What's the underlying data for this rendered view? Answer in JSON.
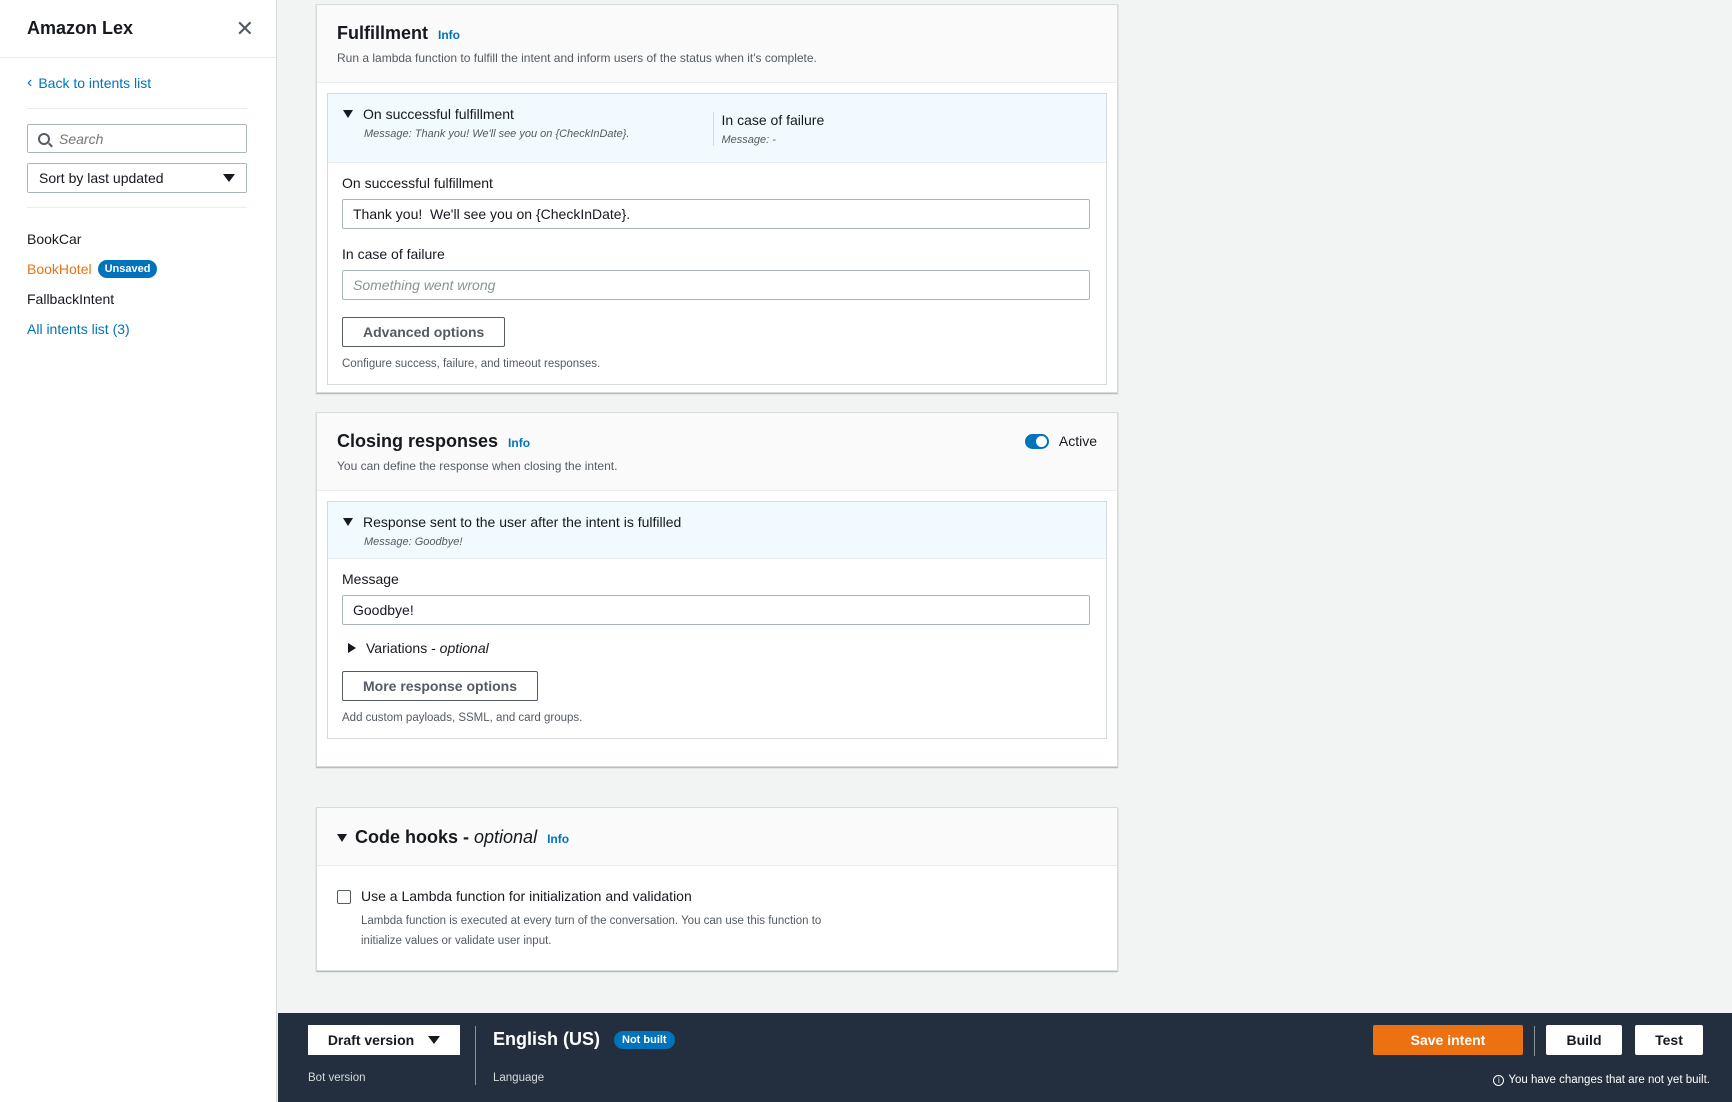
{
  "sidebar": {
    "title": "Amazon Lex",
    "back_label": "Back to intents list",
    "search_placeholder": "Search",
    "sort_label": "Sort by last updated",
    "intents": [
      {
        "label": "BookCar"
      },
      {
        "label": "BookHotel",
        "badge": "Unsaved"
      },
      {
        "label": "FallbackIntent"
      }
    ],
    "all_intents_label": "All intents list (3)"
  },
  "fulfillment": {
    "title": "Fulfillment",
    "info": "Info",
    "description": "Run a lambda function to fulfill the intent and inform users of the status when it's complete.",
    "success_header": "On successful fulfillment",
    "success_message": "Message: Thank you! We'll see you on {CheckInDate}.",
    "failure_header": "In case of failure",
    "failure_message": "Message: -",
    "success_label": "On successful fulfillment",
    "success_value": "Thank you!  We'll see you on {CheckInDate}.",
    "failure_label": "In case of failure",
    "failure_placeholder": "Something went wrong",
    "advanced_button": "Advanced options",
    "advanced_hint": "Configure success, failure, and timeout responses."
  },
  "closing": {
    "title": "Closing responses",
    "info": "Info",
    "description": "You can define the response when closing the intent.",
    "toggle_label": "Active",
    "response_header": "Response sent to the user after the intent is fulfilled",
    "response_message": "Message: Goodbye!",
    "message_label": "Message",
    "message_value": "Goodbye!",
    "variations_label": "Variations - ",
    "variations_optional": "optional",
    "more_button": "More response options",
    "more_hint": "Add custom payloads, SSML, and card groups."
  },
  "code_hooks": {
    "title": "Code hooks - ",
    "optional": "optional",
    "info": "Info",
    "checkbox_label": "Use a Lambda function for initialization and validation",
    "checkbox_desc": "Lambda function is executed at every turn of the conversation. You can use this function to initialize values or validate user input."
  },
  "bottom_bar": {
    "version_label": "Draft version",
    "version_sub": "Bot version",
    "language": "English (US)",
    "language_badge": "Not built",
    "language_sub": "Language",
    "save_button": "Save intent",
    "build_button": "Build",
    "test_button": "Test",
    "warning": "You have changes that are not yet built."
  },
  "colors": {
    "accent": "#0073bb",
    "primary_button": "#ec7211",
    "bottom_bar": "#232f3e"
  }
}
